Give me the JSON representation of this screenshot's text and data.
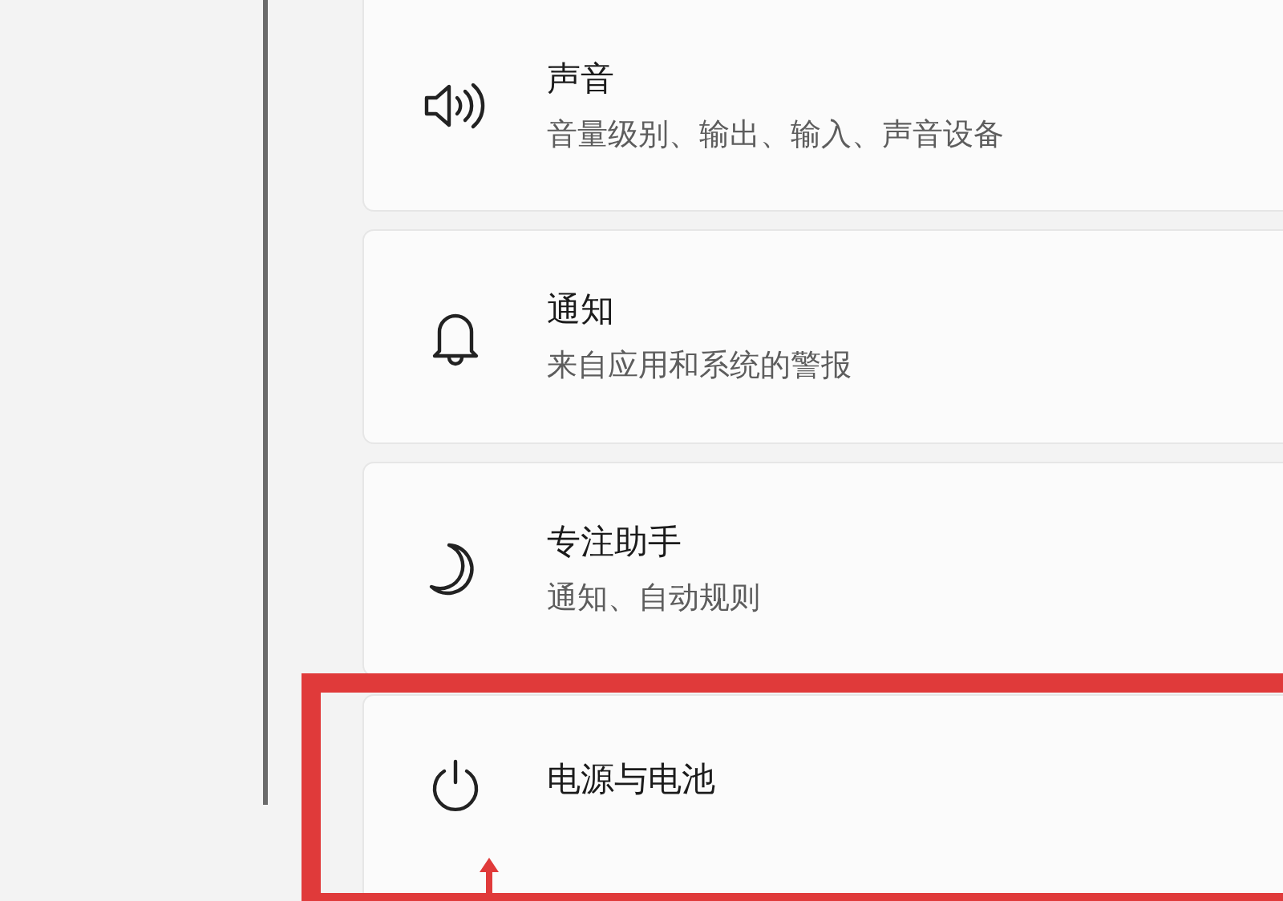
{
  "settings_items": [
    {
      "kind": "speaker",
      "title": "声音",
      "subtitle": "音量级别、输出、输入、声音设备",
      "highlighted": false
    },
    {
      "kind": "bell",
      "title": "通知",
      "subtitle": "来自应用和系统的警报",
      "highlighted": false
    },
    {
      "kind": "moon",
      "title": "专注助手",
      "subtitle": "通知、自动规则",
      "highlighted": false
    },
    {
      "kind": "power",
      "title": "电源与电池",
      "highlighted": true
    }
  ]
}
